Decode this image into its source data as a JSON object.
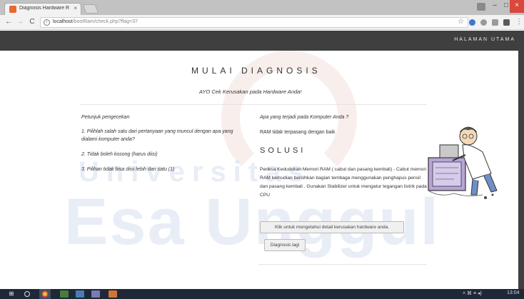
{
  "browser": {
    "tab_title": "Diagnosis Hardware RA…",
    "tab_close": "×",
    "url_host": "localhost",
    "url_path": "/bootRam/check.php?flag=37",
    "info_glyph": "i",
    "nav_back": "←",
    "nav_forward": "→",
    "nav_reload": "C",
    "star": "☆",
    "menu": "⋮",
    "win_min": "–",
    "win_max": "□",
    "win_close": "×"
  },
  "navbar": {
    "home_label": "HALAMAN UTAMA"
  },
  "page": {
    "heading": "MULAI DIAGNOSIS",
    "subheading": "AYO Cek Kerusakan pada Hardware Anda!",
    "instructions": {
      "title": "Petunjuk pengecekan",
      "items": [
        "1. Pilihlah salah satu dari pertanyaan yang muncul dengan apa yang dialami komputer anda?",
        "2. Tidak boleh kosong (harus diisi)",
        "3. Pilihan tidak bisa diisi lebih dari satu (1)"
      ]
    },
    "question": "Apa yang terjadi pada Komputer Anda ?",
    "answer": "RAM tidak terpasang dengan baik",
    "solution_title": "SOLUSI",
    "solution_text": "Periksa Kedudukan Memori RAM ( cabut dan pasang kembali) - Cabut memori RAM kemudian bersihkan bagian tembaga menggunakan penghapus pensil dan pasang kembali . Gunakan Stabilizer untuk mengatur tegangan listrik pada CPU",
    "detail_button": "Klik untuk mengetahui detail kerusakan hardware anda.",
    "again_button": "Diagnosis lagi"
  },
  "watermark": {
    "line1": "Universitas",
    "line2": "Esa Unggul"
  },
  "taskbar": {
    "start_glyph": "⊞",
    "tray_icons": "˄  ⌘  ≡  ◂)",
    "clock": "13:04"
  },
  "colors": {
    "navbar": "#3f3f3f",
    "close_button": "#d9483b",
    "taskbar": "#1e2837"
  }
}
